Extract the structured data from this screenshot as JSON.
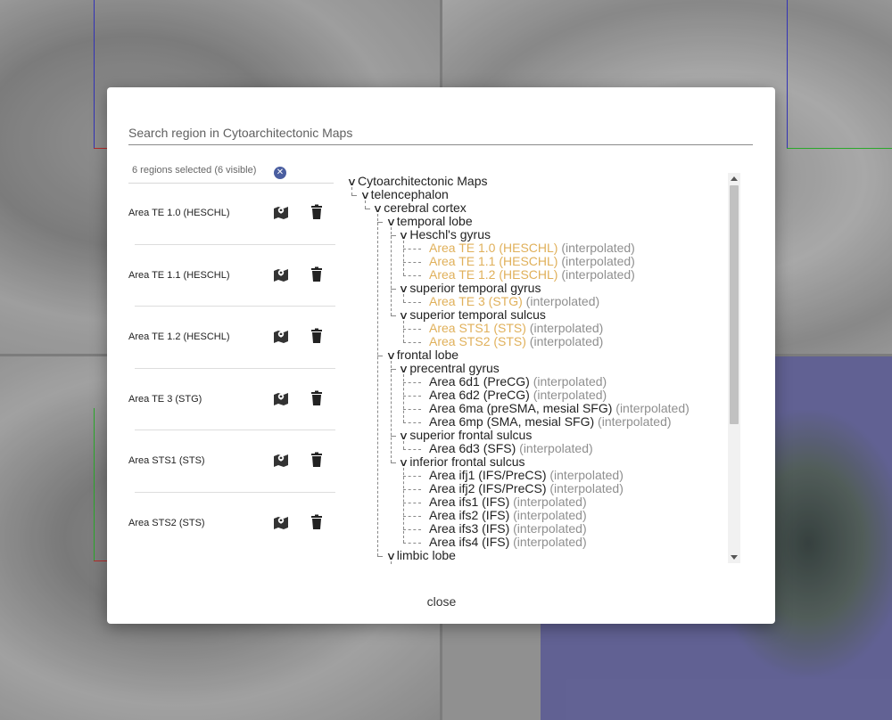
{
  "search": {
    "placeholder": "Search region in Cytoarchitectonic Maps"
  },
  "selection": {
    "count_text": "6 regions selected (6 visible)",
    "clear_icon": "x-circle-icon",
    "items": [
      {
        "label": "Area TE 1.0 (HESCHL)"
      },
      {
        "label": "Area TE 1.1 (HESCHL)"
      },
      {
        "label": "Area TE 1.2 (HESCHL)"
      },
      {
        "label": "Area TE 3 (STG)"
      },
      {
        "label": "Area STS1 (STS)"
      },
      {
        "label": "Area STS2 (STS)"
      }
    ]
  },
  "tree": {
    "rows": [
      {
        "text": "Cytoarchitectonic Maps",
        "level": 0,
        "chevron": true,
        "selected": false,
        "interp": ""
      },
      {
        "text": "telencephalon",
        "level": 1,
        "chevron": true,
        "selected": false,
        "interp": ""
      },
      {
        "text": "cerebral cortex",
        "level": 2,
        "chevron": true,
        "selected": false,
        "interp": ""
      },
      {
        "text": "temporal lobe",
        "level": 3,
        "chevron": true,
        "selected": false,
        "interp": ""
      },
      {
        "text": "Heschl's gyrus",
        "level": 4,
        "chevron": true,
        "selected": false,
        "interp": ""
      },
      {
        "text": "Area TE 1.0 (HESCHL)",
        "level": 5,
        "chevron": false,
        "selected": true,
        "interp": "(interpolated)"
      },
      {
        "text": "Area TE 1.1 (HESCHL)",
        "level": 5,
        "chevron": false,
        "selected": true,
        "interp": "(interpolated)"
      },
      {
        "text": "Area TE 1.2 (HESCHL)",
        "level": 5,
        "chevron": false,
        "selected": true,
        "interp": "(interpolated)"
      },
      {
        "text": "superior temporal gyrus",
        "level": 4,
        "chevron": true,
        "selected": false,
        "interp": ""
      },
      {
        "text": "Area TE 3 (STG)",
        "level": 5,
        "chevron": false,
        "selected": true,
        "interp": "(interpolated)"
      },
      {
        "text": "superior temporal sulcus",
        "level": 4,
        "chevron": true,
        "selected": false,
        "interp": ""
      },
      {
        "text": "Area STS1 (STS)",
        "level": 5,
        "chevron": false,
        "selected": true,
        "interp": "(interpolated)"
      },
      {
        "text": "Area STS2 (STS)",
        "level": 5,
        "chevron": false,
        "selected": true,
        "interp": "(interpolated)"
      },
      {
        "text": "frontal lobe",
        "level": 3,
        "chevron": true,
        "selected": false,
        "interp": ""
      },
      {
        "text": "precentral gyrus",
        "level": 4,
        "chevron": true,
        "selected": false,
        "interp": ""
      },
      {
        "text": "Area 6d1 (PreCG)",
        "level": 5,
        "chevron": false,
        "selected": false,
        "interp": "(interpolated)"
      },
      {
        "text": "Area 6d2 (PreCG)",
        "level": 5,
        "chevron": false,
        "selected": false,
        "interp": "(interpolated)"
      },
      {
        "text": "Area 6ma (preSMA, mesial SFG)",
        "level": 5,
        "chevron": false,
        "selected": false,
        "interp": "(interpolated)"
      },
      {
        "text": "Area 6mp (SMA, mesial SFG)",
        "level": 5,
        "chevron": false,
        "selected": false,
        "interp": "(interpolated)"
      },
      {
        "text": "superior frontal sulcus",
        "level": 4,
        "chevron": true,
        "selected": false,
        "interp": ""
      },
      {
        "text": "Area 6d3 (SFS)",
        "level": 5,
        "chevron": false,
        "selected": false,
        "interp": "(interpolated)"
      },
      {
        "text": "inferior frontal sulcus",
        "level": 4,
        "chevron": true,
        "selected": false,
        "interp": ""
      },
      {
        "text": "Area ifj1 (IFS/PreCS)",
        "level": 5,
        "chevron": false,
        "selected": false,
        "interp": "(interpolated)"
      },
      {
        "text": "Area ifj2 (IFS/PreCS)",
        "level": 5,
        "chevron": false,
        "selected": false,
        "interp": "(interpolated)"
      },
      {
        "text": "Area ifs1 (IFS)",
        "level": 5,
        "chevron": false,
        "selected": false,
        "interp": "(interpolated)"
      },
      {
        "text": "Area ifs2 (IFS)",
        "level": 5,
        "chevron": false,
        "selected": false,
        "interp": "(interpolated)"
      },
      {
        "text": "Area ifs3 (IFS)",
        "level": 5,
        "chevron": false,
        "selected": false,
        "interp": "(interpolated)"
      },
      {
        "text": "Area ifs4 (IFS)",
        "level": 5,
        "chevron": false,
        "selected": false,
        "interp": "(interpolated)"
      },
      {
        "text": "limbic lobe",
        "level": 3,
        "chevron": true,
        "selected": false,
        "interp": ""
      }
    ]
  },
  "close_label": "close",
  "colors": {
    "selected": "#e0b05a",
    "interpolated": "#8f8f8f",
    "accent": "#4a5ea0"
  }
}
